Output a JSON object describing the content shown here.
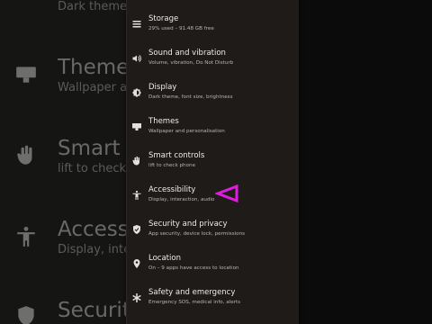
{
  "background_zoom": {
    "items": [
      {
        "title": "",
        "subtitle": "Dark theme, f",
        "icon": "display-icon"
      },
      {
        "title": "Themes",
        "subtitle": "Wallpaper and",
        "icon": "themes-icon"
      },
      {
        "title": "Smart co",
        "subtitle": "lift to check",
        "icon": "smart-controls-icon"
      },
      {
        "title": "Accessibi",
        "subtitle": "Display, inte",
        "icon": "accessibility-icon"
      },
      {
        "title": "Security",
        "subtitle": "",
        "icon": "security-icon"
      }
    ]
  },
  "settings": {
    "items": [
      {
        "title": "Storage",
        "subtitle": "29% used – 91.48 GB free",
        "icon": "storage-icon"
      },
      {
        "title": "Sound and vibration",
        "subtitle": "Volume, vibration, Do Not Disturb",
        "icon": "sound-icon"
      },
      {
        "title": "Display",
        "subtitle": "Dark theme, font size, brightness",
        "icon": "display-icon"
      },
      {
        "title": "Themes",
        "subtitle": "Wallpaper and personalisation",
        "icon": "themes-icon"
      },
      {
        "title": "Smart controls",
        "subtitle": "lift to check phone",
        "icon": "smart-controls-icon"
      },
      {
        "title": "Accessibility",
        "subtitle": "Display, interaction, audio",
        "icon": "accessibility-icon"
      },
      {
        "title": "Security and privacy",
        "subtitle": "App security, device lock, permissions",
        "icon": "security-icon"
      },
      {
        "title": "Location",
        "subtitle": "On – 9 apps have access to location",
        "icon": "location-icon"
      },
      {
        "title": "Safety and emergency",
        "subtitle": "Emergency SOS, medical info, alerts",
        "icon": "safety-icon"
      }
    ]
  },
  "colors": {
    "panel_bg": "#1e1b19",
    "marker": "#e01ce0"
  }
}
